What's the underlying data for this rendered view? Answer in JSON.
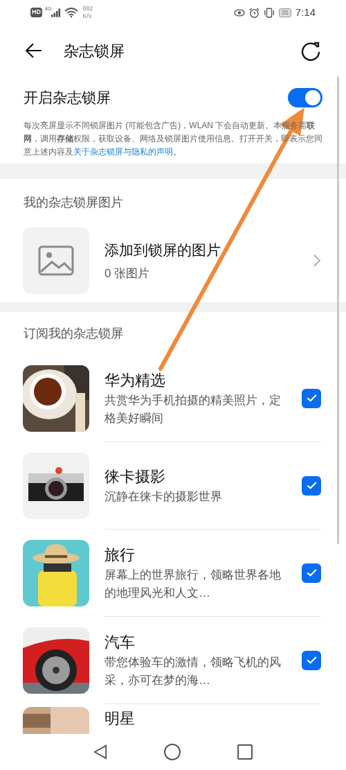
{
  "status_bar": {
    "hd": "HD",
    "network": "4G",
    "speed": "882",
    "speed_unit": "K/s",
    "battery": "35",
    "time": "7:14"
  },
  "header": {
    "title": "杂志锁屏"
  },
  "main_toggle": {
    "label": "开启杂志锁屏",
    "on": true
  },
  "description": {
    "text": "每次亮屏显示不同锁屏图片 (可能包含广告)，WLAN 下会自动更新。本服务需**联网**，调用**存储**权限，获取设备、网络及锁屏图片使用信息。打开开关，即表示您同意上述内容及",
    "link": "关于杂志锁屏与隐私的声明",
    "end": "。"
  },
  "my_pictures": {
    "heading": "我的杂志锁屏图片",
    "title": "添加到锁屏的图片",
    "count": "0 张图片"
  },
  "subscriptions": {
    "heading": "订阅我的杂志锁屏",
    "items": [
      {
        "title": "华为精选",
        "subtitle": "共赏华为手机拍摄的精美照片，定格美好瞬间",
        "checked": true
      },
      {
        "title": "徕卡摄影",
        "subtitle": "沉静在徕卡的摄影世界",
        "checked": true
      },
      {
        "title": "旅行",
        "subtitle": "屏幕上的世界旅行，领略世界各地的地理风光和人文…",
        "checked": true
      },
      {
        "title": "汽车",
        "subtitle": "带您体验车的激情，领略飞机的风采，亦可在梦的海…",
        "checked": true
      },
      {
        "title": "明星"
      }
    ]
  }
}
